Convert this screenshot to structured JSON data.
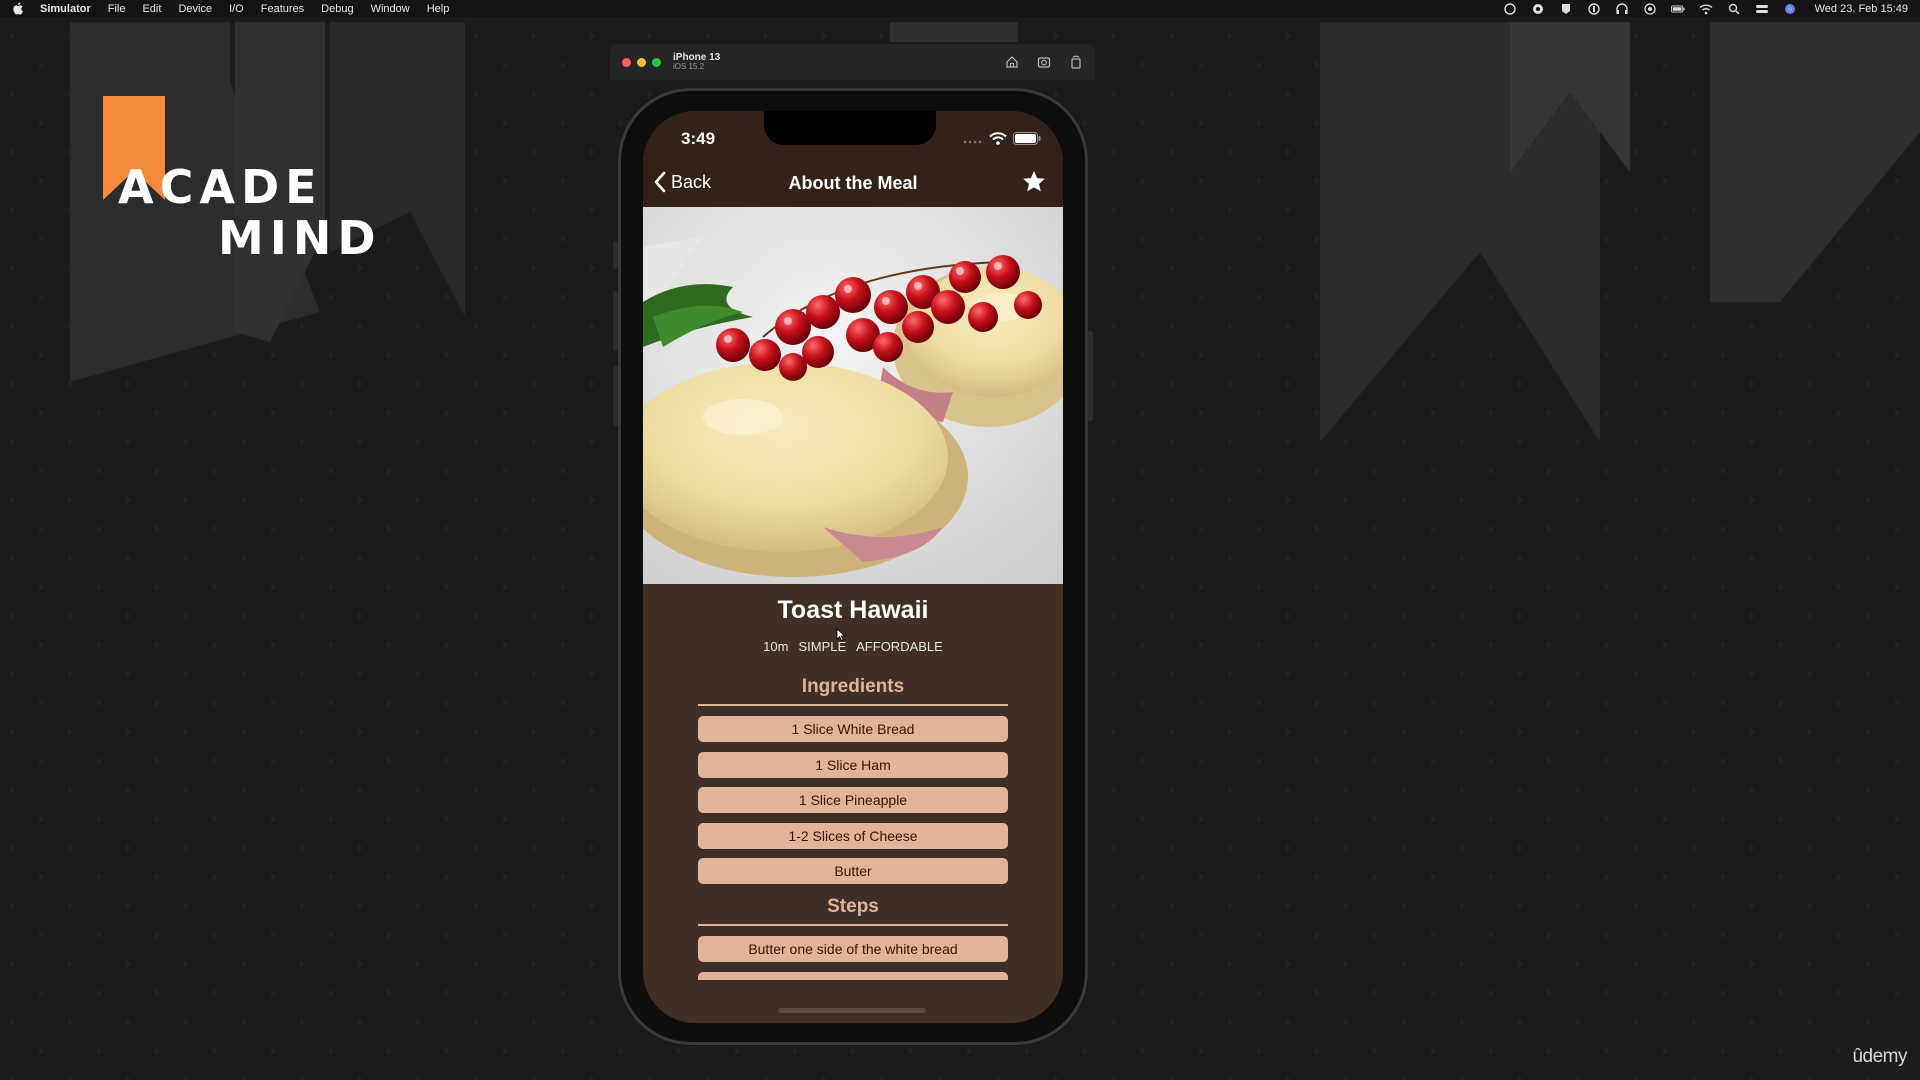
{
  "menubar": {
    "app_name": "Simulator",
    "items": [
      "File",
      "Edit",
      "Device",
      "I/O",
      "Features",
      "Debug",
      "Window",
      "Help"
    ],
    "clock": "Wed 23. Feb 15:49"
  },
  "logo": {
    "line1": "ACADE",
    "line2": "MIND",
    "accent_color": "#f58a3a"
  },
  "simulator": {
    "device_name": "iPhone 13",
    "os_version": "iOS 15.2"
  },
  "status_bar": {
    "time": "3:49"
  },
  "nav": {
    "back_label": "Back",
    "title": "About the Meal"
  },
  "meal": {
    "title": "Toast Hawaii",
    "duration": "10m",
    "complexity": "SIMPLE",
    "affordability": "AFFORDABLE",
    "ingredients_title": "Ingredients",
    "ingredients": [
      "1 Slice White Bread",
      "1 Slice Ham",
      "1 Slice Pineapple",
      "1-2 Slices of Cheese",
      "Butter"
    ],
    "steps_title": "Steps",
    "steps": [
      "Butter one side of the white bread"
    ]
  },
  "colors": {
    "app_bar": "#33221a",
    "background": "#3f2f25",
    "accent": "#e2b497",
    "pill_text": "#351401"
  },
  "watermark": "ûdemy"
}
